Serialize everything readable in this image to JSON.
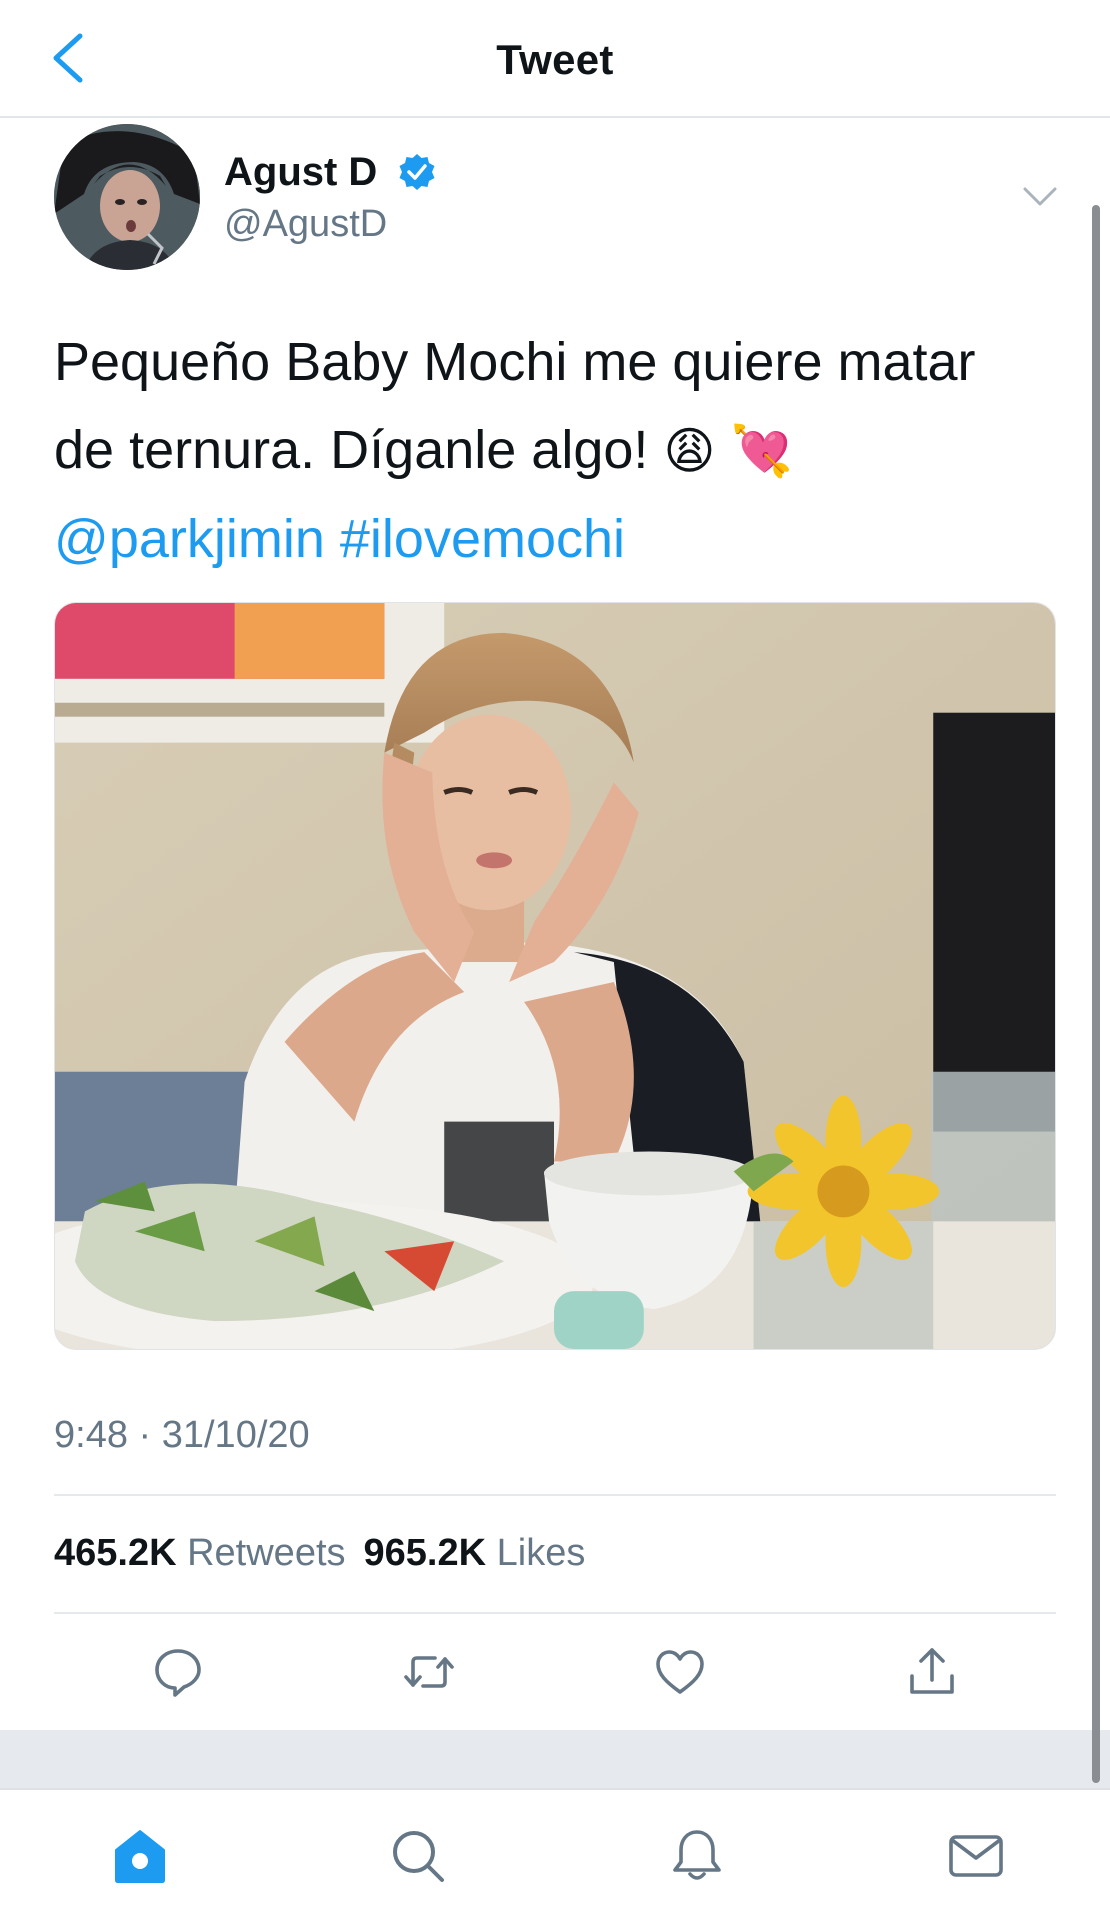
{
  "header": {
    "title": "Tweet",
    "back_icon": "chevron-left-icon"
  },
  "author": {
    "display_name": "Agust D",
    "handle": "@AgustD",
    "verified": true,
    "verified_icon": "verified-badge-icon"
  },
  "tweet": {
    "text_line1": "Pequeño Baby Mochi me quiere matar",
    "text_line2": "de ternura. Díganle algo!",
    "emoji1": "😩",
    "emoji2": "💘",
    "mention": "@parkjimin",
    "hashtag": "#ilovemochi",
    "timestamp": "9:48 · 31/10/20"
  },
  "stats": {
    "retweets_count": "465.2K",
    "retweets_label": "Retweets",
    "likes_count": "965.2K",
    "likes_label": "Likes"
  },
  "actions": [
    "reply-icon",
    "retweet-icon",
    "like-icon",
    "share-icon"
  ],
  "tabs": [
    "home-icon",
    "search-icon",
    "notifications-icon",
    "messages-icon"
  ],
  "colors": {
    "accent": "#1d9bf0",
    "muted": "#657786",
    "text": "#0f1419"
  }
}
